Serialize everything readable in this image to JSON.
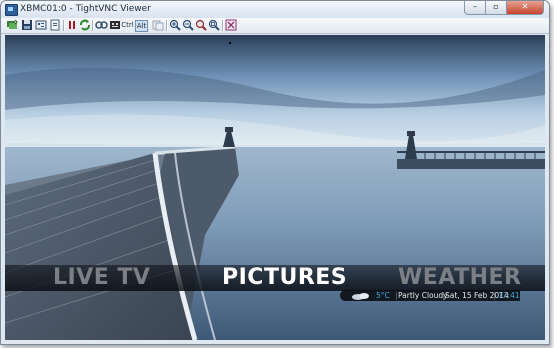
{
  "window": {
    "title": "XBMC01:0 - TightVNC Viewer",
    "controls": {
      "minimize": "–",
      "maximize": "▫",
      "close": "✕"
    }
  },
  "toolbar": {
    "ctrl_label": "Ctrl",
    "alt_label": "Alt",
    "icons": [
      "new-connection-icon",
      "save-session-icon",
      "options-icon",
      "connection-info-icon",
      "pause-icon",
      "refresh-icon",
      "transfer-files-icon",
      "ctrl-alt-del-icon",
      "ctrl-key-icon",
      "alt-key-icon",
      "clipboard-icon",
      "zoom-in-icon",
      "zoom-out-icon",
      "zoom-100-icon",
      "zoom-fit-icon",
      "fullscreen-icon"
    ]
  },
  "xbmc": {
    "menu": [
      {
        "label": "LIVE TV",
        "state": "inactive"
      },
      {
        "label": "PICTURES",
        "state": "active"
      },
      {
        "label": "WEATHER",
        "state": "inactive"
      }
    ],
    "status": {
      "weather_icon": "partly-cloudy-icon",
      "temperature": "5°C",
      "condition": "Partly Cloudy",
      "date": "Sat, 15 Feb 2014",
      "time": "17:41"
    }
  },
  "colors": {
    "accent": "#3fa9e0",
    "menu_active": "#ffffff",
    "menu_inactive": "#7b8086",
    "window_frame": "#dfe7f1"
  }
}
